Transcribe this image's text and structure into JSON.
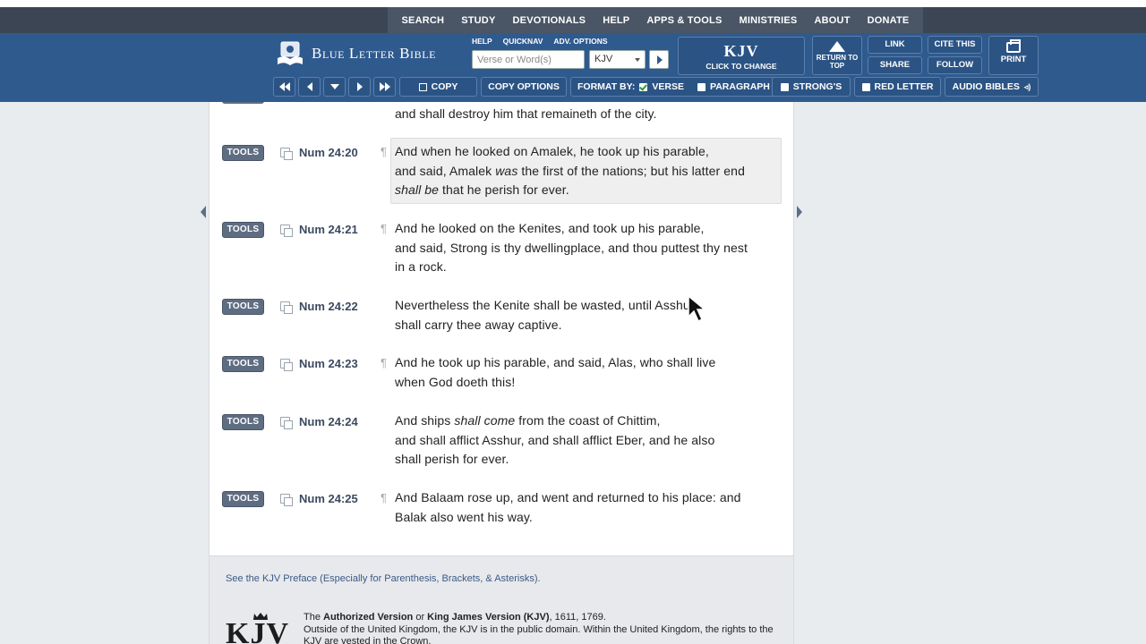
{
  "topnav": {
    "items": [
      "SEARCH",
      "STUDY",
      "DEVOTIONALS",
      "HELP",
      "APPS & TOOLS",
      "MINISTRIES",
      "ABOUT",
      "DONATE"
    ]
  },
  "header": {
    "logo_text": "Blue Letter Bible",
    "mini_links": [
      "HELP",
      "QUICKNAV",
      "ADV. OPTIONS"
    ],
    "search_placeholder": "Verse or Word(s)",
    "version_selected": "KJV",
    "kjv_title": "KJV",
    "kjv_sub": "CLICK TO CHANGE",
    "return_top": "RETURN TO TOP",
    "link": "LINK",
    "cite": "CITE THIS",
    "share": "SHARE",
    "follow": "FOLLOW",
    "print": "PRINT"
  },
  "toolbar": {
    "copy": "COPY",
    "copy_options": "COPY OPTIONS",
    "format_by": "FORMAT BY:",
    "verse": "VERSE",
    "paragraph": "PARAGRAPH",
    "strongs": "STRONG'S",
    "red_letter": "RED LETTER",
    "audio": "AUDIO BIBLES"
  },
  "content": {
    "top_text": "and shall destroy him that remaineth of the city.",
    "tools_label": "TOOLS",
    "verses": [
      {
        "ref": "Num 24:20",
        "pilcrow": true,
        "lines": [
          "And when he looked on Amalek, he took up his parable,",
          "and said, Amalek <i>was</i> the first of the nations; but his latter end",
          "<i>shall be</i> that he perish for ever."
        ]
      },
      {
        "ref": "Num 24:21",
        "pilcrow": true,
        "lines": [
          "And he looked on the Kenites, and took up his parable,",
          "and said, Strong is thy dwellingplace, and thou puttest thy nest",
          "in a rock."
        ]
      },
      {
        "ref": "Num 24:22",
        "pilcrow": false,
        "lines": [
          "Nevertheless the Kenite shall be wasted, until Asshur",
          "shall carry thee away captive."
        ]
      },
      {
        "ref": "Num 24:23",
        "pilcrow": true,
        "lines": [
          "And he took up his parable, and said, Alas, who shall live",
          "when God doeth this!"
        ]
      },
      {
        "ref": "Num 24:24",
        "pilcrow": false,
        "lines": [
          "And ships <i>shall come</i> from the coast of Chittim,",
          "and shall afflict Asshur, and shall afflict Eber, and he also",
          "shall perish for ever."
        ]
      },
      {
        "ref": "Num 24:25",
        "pilcrow": true,
        "lines": [
          "And Balaam rose up, and went and returned to his place: and",
          "Balak also went his way."
        ]
      }
    ]
  },
  "footer": {
    "preface": "See the KJV Preface (Especially for Parenthesis, Brackets, & Asterisks).",
    "logo_letters": "KJV",
    "auth_line1_a": "The ",
    "auth_line1_b": "Authorized Version",
    "auth_line1_c": " or ",
    "auth_line1_d": "King James Version (KJV)",
    "auth_line1_e": ", 1611, 1769.",
    "auth_line2": "Outside of the United Kingdom, the KJV is in the public domain. Within the United Kingdom, the rights to the KJV are vested in the Crown."
  },
  "colors": {
    "header_blue": "#2f5a8e",
    "topnav_dark": "#3c4553",
    "tools_badge": "#5f6d82",
    "ref_text": "#3b4a60"
  }
}
